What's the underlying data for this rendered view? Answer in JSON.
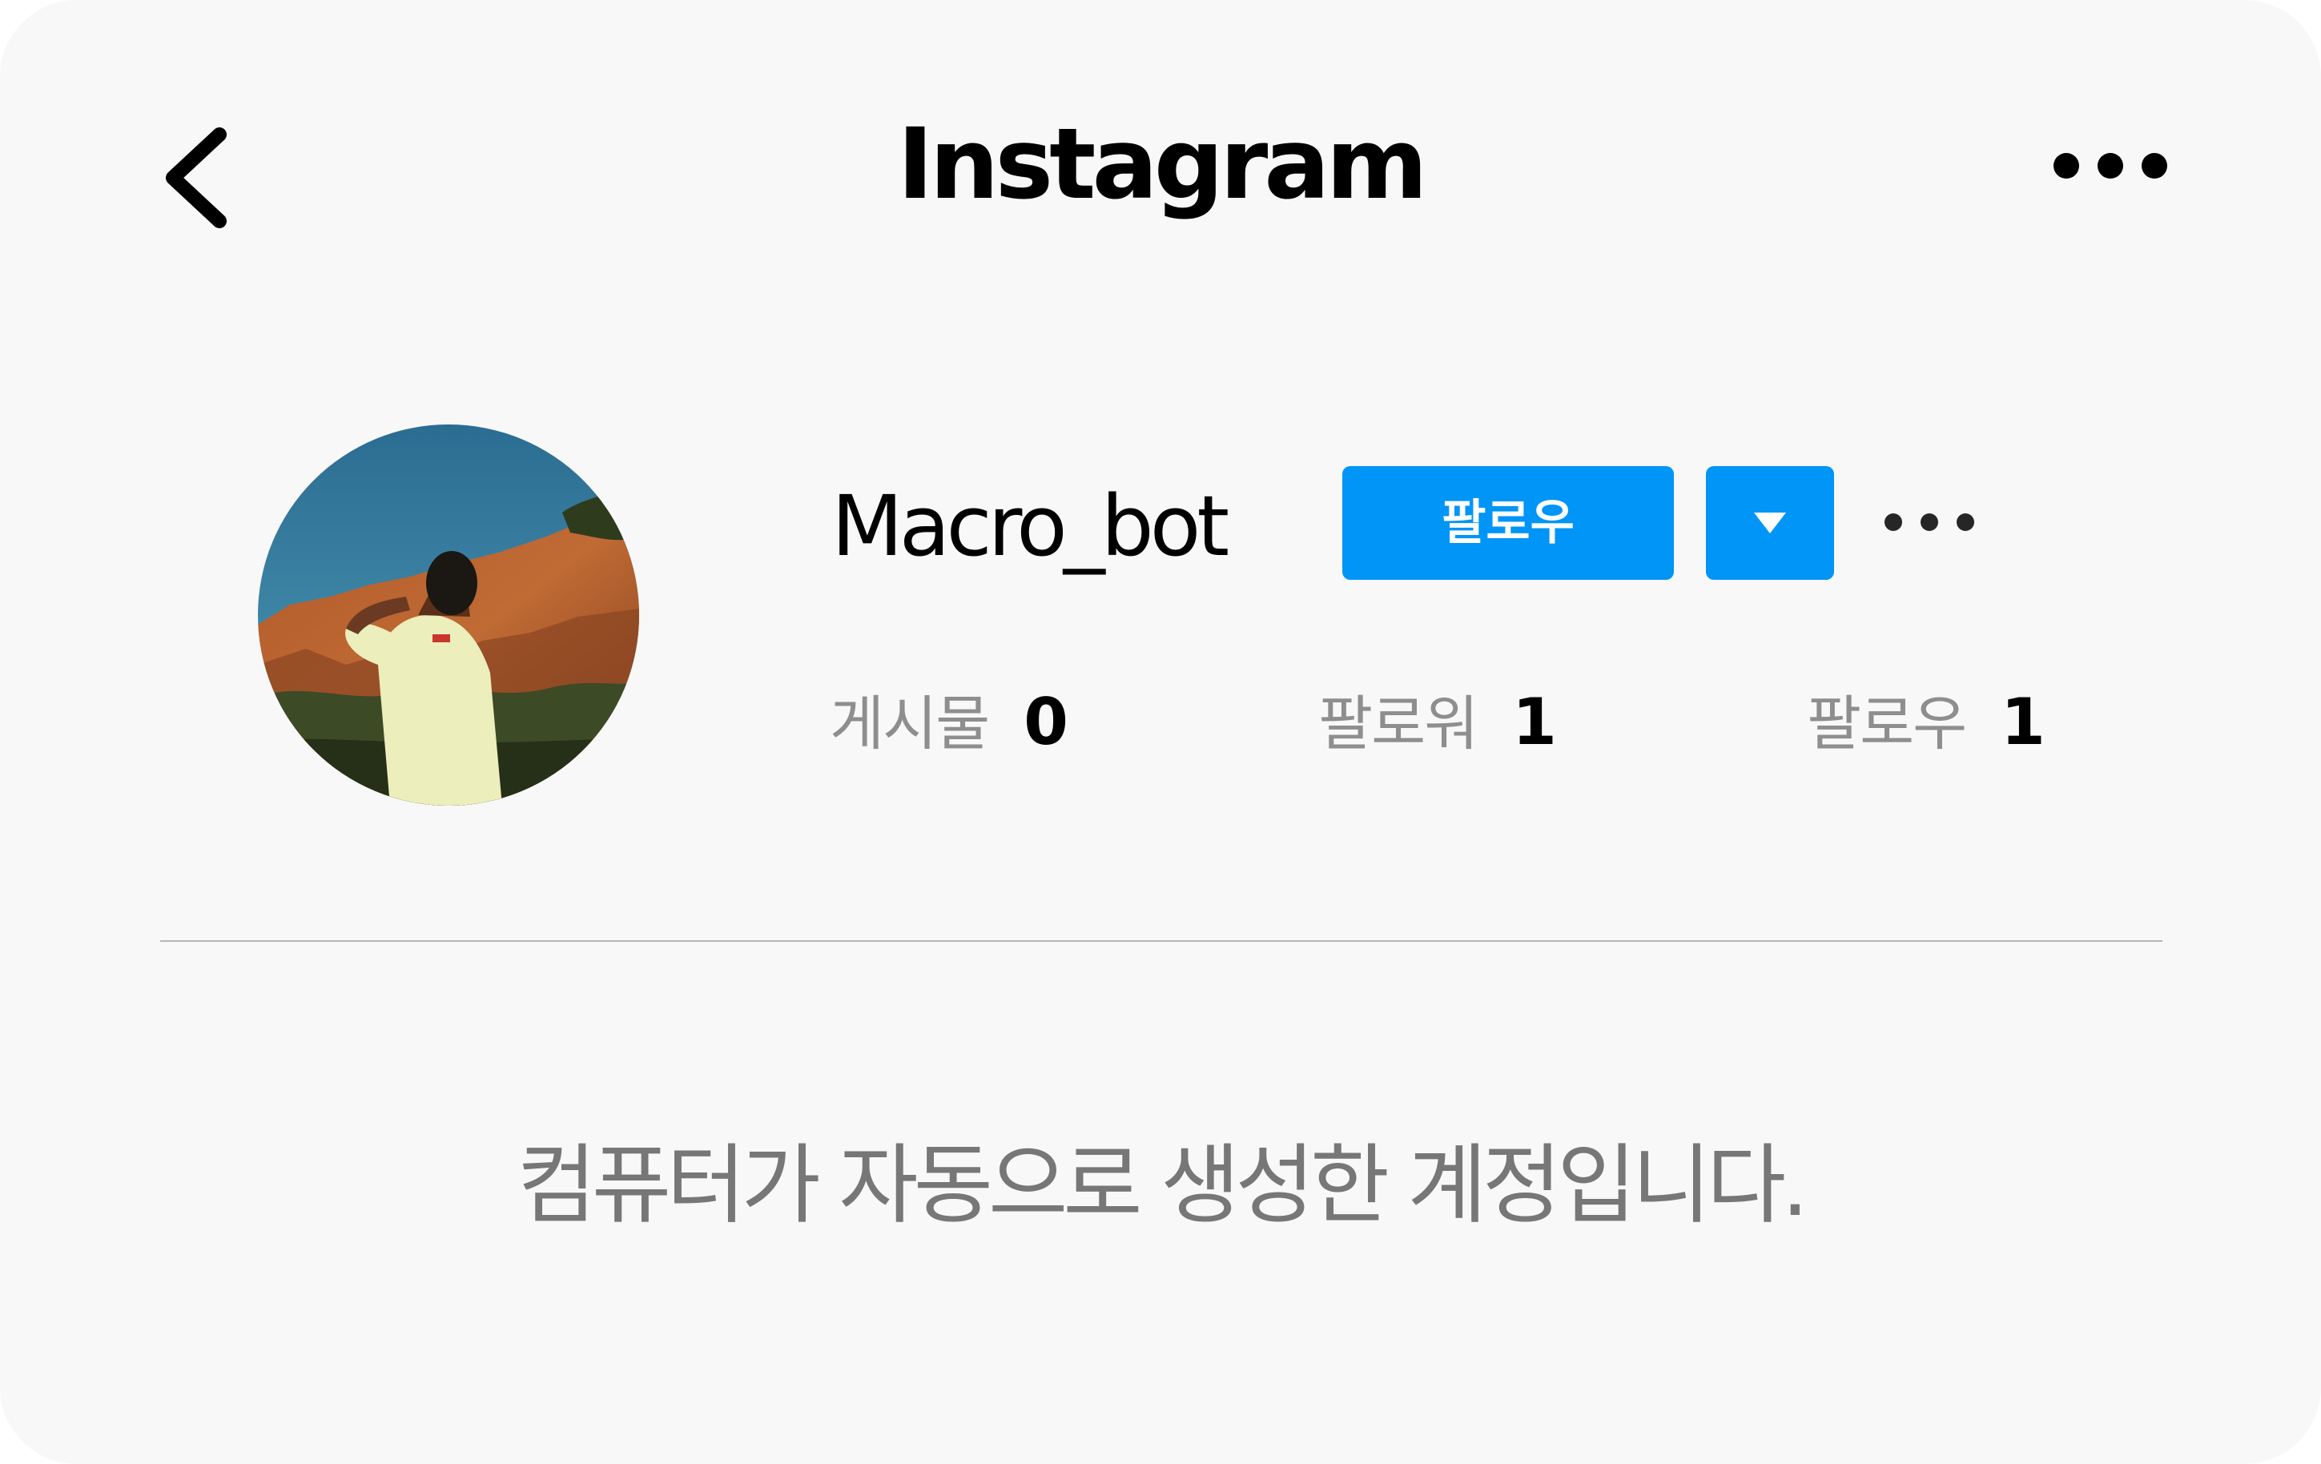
{
  "header": {
    "title": "Instagram",
    "back_icon": "chevron-left-icon",
    "more_icon": "more-horizontal-icon"
  },
  "profile": {
    "username": "Macro_bot",
    "follow_label": "팔로우",
    "dropdown_icon": "caret-down-icon",
    "more_icon": "more-horizontal-icon",
    "accent_color": "#0095f6",
    "stats": {
      "posts_label": "게시물",
      "posts_value": "0",
      "followers_label": "팔로워",
      "followers_value": "1",
      "following_label": "팔로우",
      "following_value": "1"
    }
  },
  "bio": "컴퓨터가 자동으로 생성한 계정입니다."
}
